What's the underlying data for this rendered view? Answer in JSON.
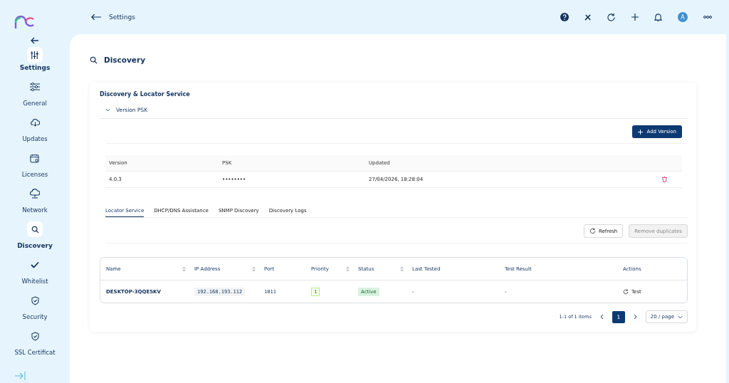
{
  "topbar": {
    "back_label": "Settings",
    "avatar": "A"
  },
  "sidebar": {
    "header": "Settings",
    "items": [
      {
        "label": "General",
        "selected": false
      },
      {
        "label": "Updates",
        "selected": false
      },
      {
        "label": "Licenses",
        "selected": false
      },
      {
        "label": "Network",
        "selected": false
      },
      {
        "label": "Discovery",
        "selected": true
      },
      {
        "label": "Whitelist",
        "selected": false
      },
      {
        "label": "Security",
        "selected": false
      },
      {
        "label": "SSL Certificat",
        "selected": false
      }
    ]
  },
  "page": {
    "title": "Discovery",
    "section_title": "Discovery & Locator Service"
  },
  "version_psk": {
    "title": "Version PSK",
    "expanded": true,
    "add_button": "Add Version",
    "columns": [
      "Version",
      "PSK",
      "Updated"
    ],
    "rows": [
      {
        "version": "4.0.3",
        "psk": "••••••••",
        "updated": "27/04/2026, 18:28:04"
      }
    ]
  },
  "tabs": [
    {
      "label": "Locator Service",
      "selected": true
    },
    {
      "label": "DHCP/DNS Assistance",
      "selected": false
    },
    {
      "label": "SNMP Discovery",
      "selected": false
    },
    {
      "label": "Discovery Logs",
      "selected": false
    }
  ],
  "toolbar": {
    "refresh": "Refresh",
    "remove_duplicates": "Remove duplicates",
    "remove_disabled": true
  },
  "table": {
    "columns": [
      {
        "label": "Name",
        "sortable": true
      },
      {
        "label": "IP Address",
        "sortable": true
      },
      {
        "label": "Port",
        "sortable": false
      },
      {
        "label": "Priority",
        "sortable": true
      },
      {
        "label": "Status",
        "sortable": true
      },
      {
        "label": "Last Tested",
        "sortable": false
      },
      {
        "label": "Test Result",
        "sortable": false
      },
      {
        "label": "Actions",
        "sortable": false
      }
    ],
    "rows": [
      {
        "name": "DESKTOP-3QQE5KV",
        "ip": "192.168.193.112",
        "port": "1011",
        "priority": "1",
        "status": "Active",
        "last_tested": "-",
        "test_result": "-",
        "action": "Test"
      }
    ]
  },
  "pagination": {
    "summary": "1-1 of 1 items",
    "pages": [
      {
        "label": "1",
        "selected": true
      }
    ],
    "page_size": "20 / page"
  }
}
